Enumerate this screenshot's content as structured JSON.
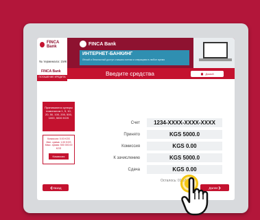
{
  "banner": {
    "brand": "FINCA Bank",
    "terminal_label": "№ терминала: 1МК",
    "ib_title": "ИНТЕРНЕТ-БАНКИНГ",
    "ib_desc": "Лёгкий и безопасный доступ к вашим счетам и операциям в любое время"
  },
  "header": {
    "logo": "FINCA Bank",
    "logo_sub": "ПОГАШЕНИЕ КРЕДИТА",
    "title": "Введите средства",
    "home_label": "Домой"
  },
  "left": {
    "info_text": "Принимаются купюры номиналом 1, 5, 10, 20, 50, 100, 200, 500, 1000, 5000 KGS",
    "limit_text": "Комиссия: 0.00 KGS Мин. сумма: 1.00 KGS Макс. сумма: 500 000.00 KGS",
    "commission_label": "Комиссия"
  },
  "fields": [
    {
      "label": "Счет",
      "value": "1234-XXXX-XXXX-XXXX"
    },
    {
      "label": "Принято",
      "value": "KGS 5000.0"
    },
    {
      "label": "Комиссия",
      "value": "KGS 0.00"
    },
    {
      "label": "К зачислению",
      "value": "KGS 5000.0"
    },
    {
      "label": "Сдача",
      "value": "KGS 0.00"
    }
  ],
  "timer": "Осталось: 01:57",
  "nav": {
    "back_label": "Назад",
    "next_label": "Далее"
  },
  "colors": {
    "background": "#b3163a",
    "accent": "#c4122f",
    "tap_highlight": "#f3c613"
  },
  "icons": {
    "home": "home-icon",
    "back": "chevron-left-icon",
    "next": "chevron-right-icon",
    "tap": "hand-pointer-icon"
  }
}
